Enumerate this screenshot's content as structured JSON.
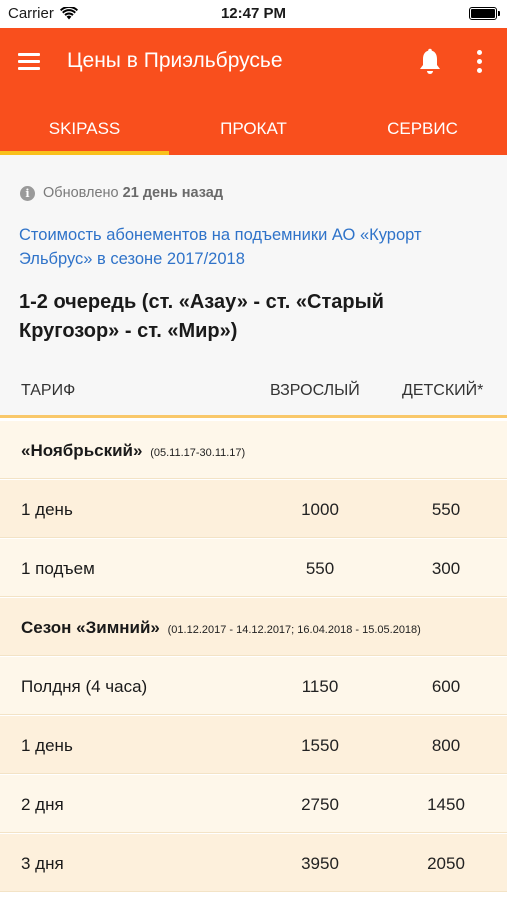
{
  "status_bar": {
    "carrier": "Carrier",
    "time": "12:47 PM",
    "battery_percent": 100
  },
  "app_bar": {
    "title": "Цены в Приэльбрусье",
    "icons": [
      "menu-icon",
      "bell-icon",
      "more-vertical-icon"
    ]
  },
  "tabs": [
    {
      "label": "SKIPASS",
      "selected": true
    },
    {
      "label": "ПРОКАТ",
      "selected": false
    },
    {
      "label": "СЕРВИС",
      "selected": false
    }
  ],
  "info": {
    "updated_prefix": "Обновлено",
    "updated_value": "21 день назад",
    "link_text": "Стоимость абонементов на подъемники АО «Курорт Эльбрус» в сезоне 2017/2018",
    "section_title": "1-2 очередь (ст. «Азау» - ст. «Старый Кругозор» - ст. «Мир»)"
  },
  "table": {
    "headers": {
      "tariff": "ТАРИФ",
      "adult": "ВЗРОСЛЫЙ",
      "child": "ДЕТСКИЙ*"
    },
    "rows": [
      {
        "name": "«Ноябрьский»",
        "dates": "(05.11.17-30.11.17)"
      },
      {
        "label": "1 день",
        "adult": "1000",
        "child": "550"
      },
      {
        "label": "1 подъем",
        "adult": "550",
        "child": "300"
      },
      {
        "name": "Сезон «Зимний»",
        "dates": "(01.12.2017 - 14.12.2017; 16.04.2018 - 15.05.2018)"
      },
      {
        "label": "Полдня (4 часа)",
        "adult": "1150",
        "child": "600"
      },
      {
        "label": "1 день",
        "adult": "1550",
        "child": "800"
      },
      {
        "label": "2 дня",
        "adult": "2750",
        "child": "1450"
      },
      {
        "label": "3 дня",
        "adult": "3950",
        "child": "2050"
      }
    ]
  },
  "colors": {
    "accent": "#f94f1d",
    "tab_indicator": "#f9c11c",
    "link": "#2f73c9"
  }
}
